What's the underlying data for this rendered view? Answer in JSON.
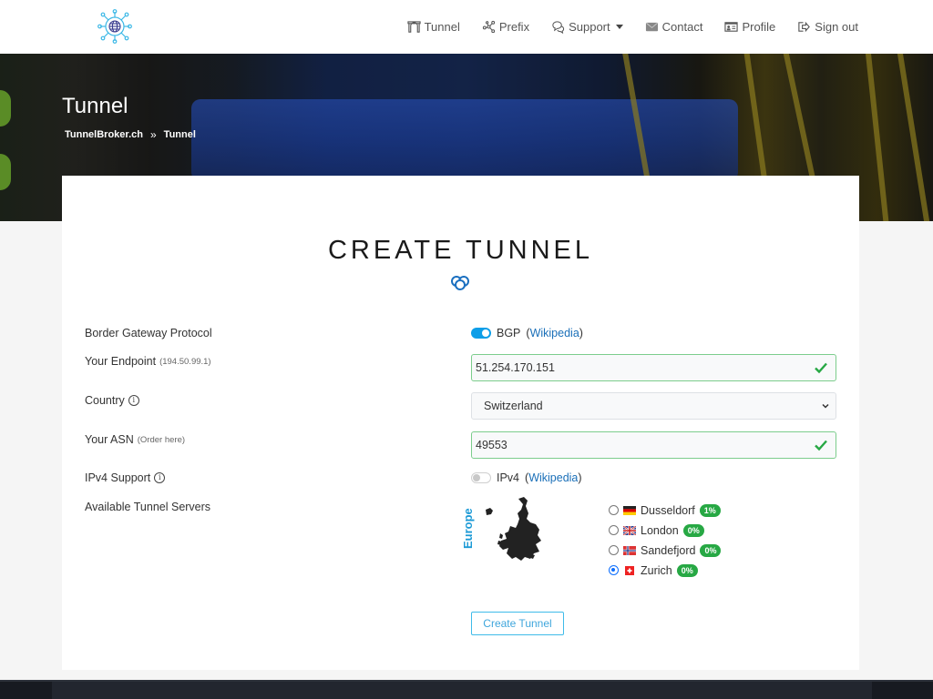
{
  "nav": {
    "logo_icon": "globe-network-icon",
    "items": [
      {
        "label": "Tunnel",
        "icon": "tunnel-icon"
      },
      {
        "label": "Prefix",
        "icon": "network-nodes-icon"
      },
      {
        "label": "Support",
        "icon": "chat-icon",
        "dropdown": true
      },
      {
        "label": "Contact",
        "icon": "envelope-icon"
      },
      {
        "label": "Profile",
        "icon": "id-card-icon"
      },
      {
        "label": "Sign out",
        "icon": "sign-out-icon"
      }
    ]
  },
  "hero": {
    "title": "Tunnel",
    "breadcrumb": [
      "TunnelBroker.ch",
      "Tunnel"
    ],
    "breadcrumb_separator": "»"
  },
  "form": {
    "title": "CREATE TUNNEL",
    "bgp": {
      "label": "Border Gateway Protocol",
      "toggle_label": "BGP",
      "link": "Wikipedia",
      "enabled": true
    },
    "endpoint": {
      "label": "Your Endpoint",
      "hint": "(194.50.99.1)",
      "value": "51.254.170.151",
      "valid": true
    },
    "country": {
      "label": "Country",
      "value": "Switzerland"
    },
    "asn": {
      "label": "Your ASN",
      "hint": "(Order here)",
      "value": "49553",
      "valid": true
    },
    "ipv4": {
      "label": "IPv4 Support",
      "toggle_label": "IPv4",
      "link": "Wikipedia",
      "enabled": false
    },
    "servers": {
      "label": "Available Tunnel Servers",
      "region": "Europe",
      "items": [
        {
          "name": "Dusseldorf",
          "load": "1%",
          "flag": "germany",
          "selected": false
        },
        {
          "name": "London",
          "load": "0%",
          "flag": "uk",
          "selected": false
        },
        {
          "name": "Sandefjord",
          "load": "0%",
          "flag": "norway",
          "selected": false
        },
        {
          "name": "Zurich",
          "load": "0%",
          "flag": "switzerland",
          "selected": true
        }
      ]
    },
    "submit_label": "Create Tunnel"
  },
  "colors": {
    "accent": "#0d9ee8",
    "valid": "#27a844",
    "link": "#1a6fb8"
  }
}
